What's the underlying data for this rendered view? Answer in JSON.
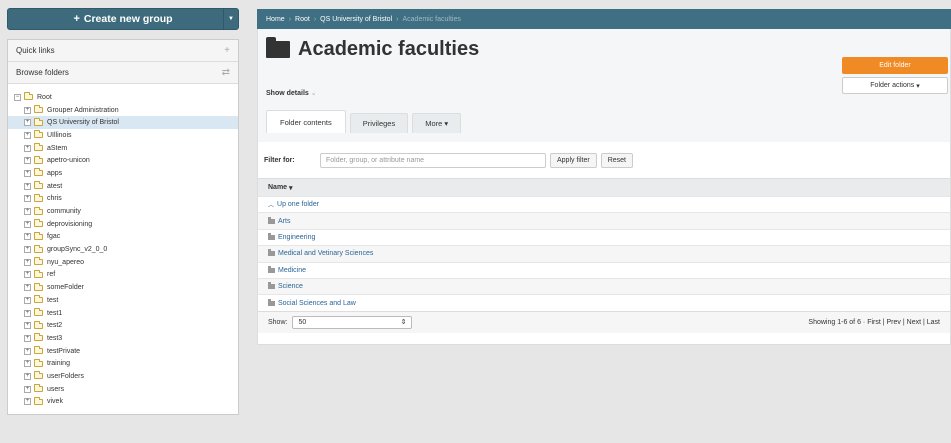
{
  "create_button": {
    "label": "Create new group",
    "icon": "plus-icon"
  },
  "left_panel": {
    "quick_links": "Quick links",
    "browse_folders": "Browse folders",
    "root_label": "Root",
    "tree": [
      "Grouper Administration",
      "QS University of Bristol",
      "UIllinois",
      "aStem",
      "apetro-unicon",
      "apps",
      "atest",
      "chris",
      "community",
      "deprovisioning",
      "fgac",
      "groupSync_v2_0_0",
      "nyu_apereo",
      "ref",
      "someFolder",
      "test",
      "test1",
      "test2",
      "test3",
      "testPrivate",
      "training",
      "userFolders",
      "users",
      "vivek"
    ],
    "selected_index": 1
  },
  "breadcrumb": {
    "home": "Home",
    "root": "Root",
    "parent": "QS University of Bristol",
    "current": "Academic faculties"
  },
  "page": {
    "title": "Academic faculties",
    "show_details": "Show details",
    "edit_button": "Edit folder",
    "actions_button": "Folder actions"
  },
  "tabs": [
    "Folder contents",
    "Privileges",
    "More"
  ],
  "filter": {
    "label": "Filter for:",
    "placeholder": "Folder, group, or attribute name",
    "apply": "Apply filter",
    "reset": "Reset"
  },
  "table": {
    "header": "Name",
    "up_one": "Up one folder",
    "rows": [
      "Arts",
      "Engineering",
      "Medical and Vetinary Sciences",
      "Medicine",
      "Science",
      "Social Sciences and Law"
    ]
  },
  "footer": {
    "show_label": "Show:",
    "show_value": "50",
    "showing": "Showing 1-6 of 6 · ",
    "first": "First",
    "prev": "Prev",
    "next": "Next",
    "last": "Last"
  },
  "colors": {
    "header_bar": "#3f6f82",
    "edit_button": "#f08a24",
    "link": "#2a6496"
  }
}
